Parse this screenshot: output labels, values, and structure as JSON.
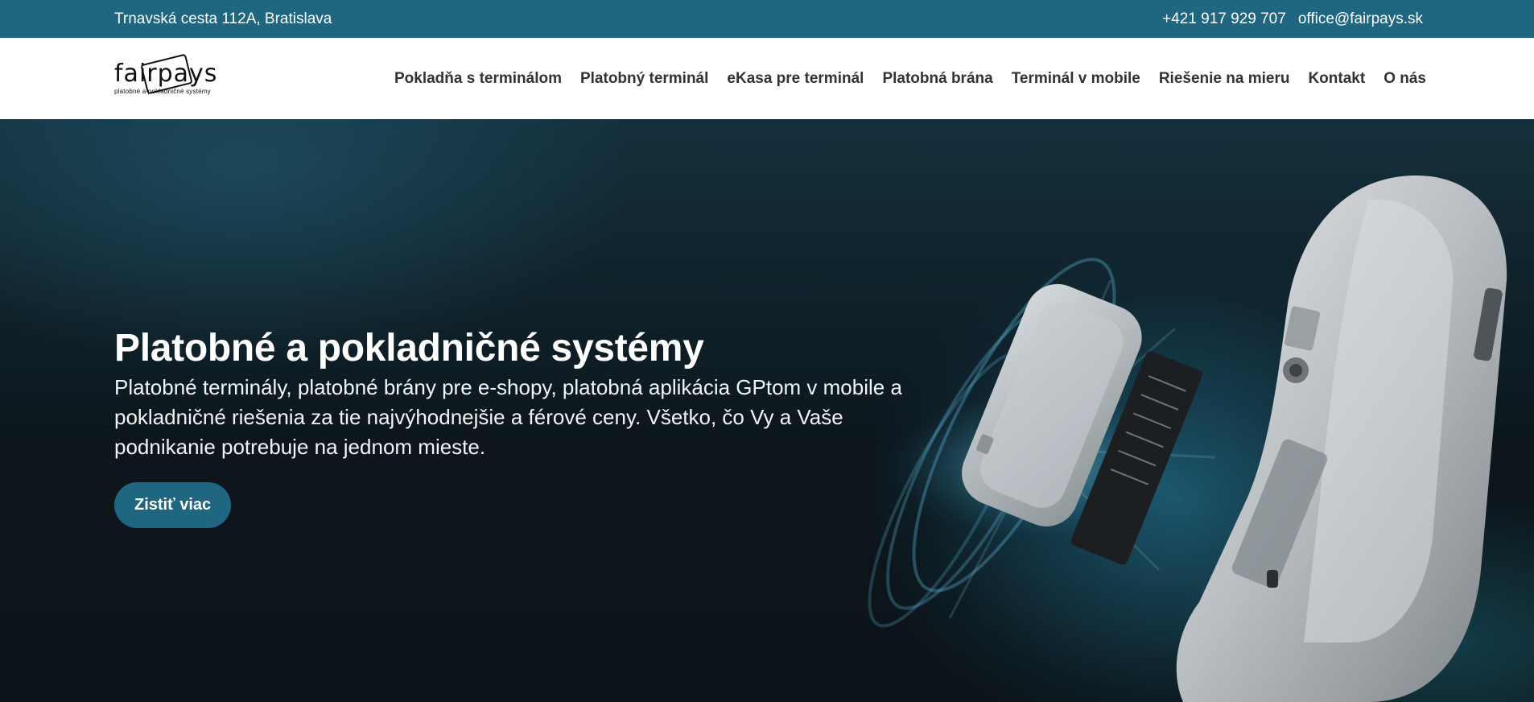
{
  "topbar": {
    "address": "Trnavská cesta 112A, Bratislava",
    "phone": "+421 917 929 707",
    "email": "office@fairpays.sk"
  },
  "logo": {
    "word": "fairpays",
    "tagline": "platobné a pokladničné systémy"
  },
  "nav": {
    "items": [
      {
        "label": "Pokladňa s terminálom"
      },
      {
        "label": "Platobný terminál"
      },
      {
        "label": "eKasa pre terminál"
      },
      {
        "label": "Platobná brána"
      },
      {
        "label": "Terminál v mobile"
      },
      {
        "label": "Riešenie na mieru"
      },
      {
        "label": "Kontakt"
      },
      {
        "label": "O nás"
      }
    ]
  },
  "hero": {
    "title": "Platobné a pokladničné systémy",
    "text": "Platobné terminály, platobné brány pre e-shopy, platobná aplikácia GPtom v mobile a pokladničné riešenia za tie najvýhodnejšie a férové ceny. Všetko, čo Vy a Vaše podnikanie potrebuje na jednom mieste.",
    "button_label": "Zistiť viac"
  },
  "colors": {
    "brand": "#1f6680",
    "nav_text": "#333333",
    "hero_bg": "#0d1a20"
  }
}
